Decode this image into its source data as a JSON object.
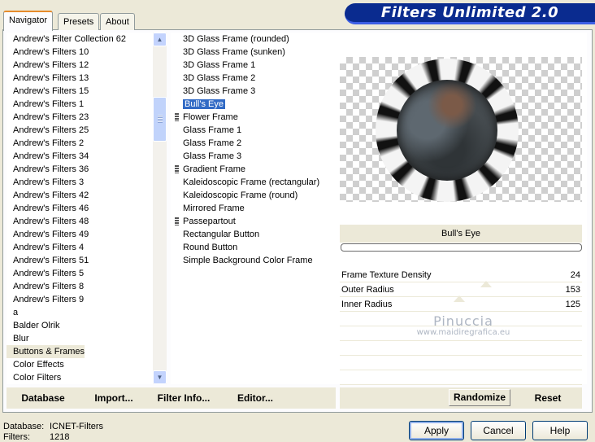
{
  "tabs": [
    {
      "label": "Navigator",
      "active": true
    },
    {
      "label": "Presets",
      "active": false
    },
    {
      "label": "About",
      "active": false
    }
  ],
  "banner": {
    "title": "Filters Unlimited 2.0"
  },
  "categories": {
    "items": [
      "Andrew's Filter Collection 62",
      "Andrew's Filters 10",
      "Andrew's Filters 12",
      "Andrew's Filters 13",
      "Andrew's Filters 15",
      "Andrew's Filters 1",
      "Andrew's Filters 23",
      "Andrew's Filters 25",
      "Andrew's Filters 2",
      "Andrew's Filters 34",
      "Andrew's Filters 36",
      "Andrew's Filters 3",
      "Andrew's Filters 42",
      "Andrew's Filters 46",
      "Andrew's Filters 48",
      "Andrew's Filters 49",
      "Andrew's Filters 4",
      "Andrew's Filters 51",
      "Andrew's Filters 5",
      "Andrew's Filters 8",
      "Andrew's Filters 9",
      "a",
      "Balder Olrik",
      "Blur",
      "Buttons & Frames",
      "Color Effects",
      "Color Filters"
    ],
    "selected_index": 24
  },
  "filters": {
    "items": [
      {
        "label": "3D Glass Frame (rounded)",
        "grip": false
      },
      {
        "label": "3D Glass Frame (sunken)",
        "grip": false
      },
      {
        "label": "3D Glass Frame 1",
        "grip": false
      },
      {
        "label": "3D Glass Frame 2",
        "grip": false
      },
      {
        "label": "3D Glass Frame 3",
        "grip": false
      },
      {
        "label": "Bull's Eye",
        "grip": false
      },
      {
        "label": "Flower Frame",
        "grip": true
      },
      {
        "label": "Glass Frame 1",
        "grip": false
      },
      {
        "label": "Glass Frame 2",
        "grip": false
      },
      {
        "label": "Glass Frame 3",
        "grip": false
      },
      {
        "label": "Gradient Frame",
        "grip": true
      },
      {
        "label": "Kaleidoscopic Frame (rectangular)",
        "grip": false
      },
      {
        "label": "Kaleidoscopic Frame (round)",
        "grip": false
      },
      {
        "label": "Mirrored Frame",
        "grip": false
      },
      {
        "label": "Passepartout",
        "grip": true
      },
      {
        "label": "Rectangular Button",
        "grip": false
      },
      {
        "label": "Round Button",
        "grip": false
      },
      {
        "label": "Simple Background Color Frame",
        "grip": false
      }
    ],
    "selected_index": 5
  },
  "preview": {
    "filter_name": "Bull's Eye"
  },
  "controls": [
    {
      "label": "Frame Texture Density",
      "value": "24"
    },
    {
      "label": "Outer Radius",
      "value": "153"
    },
    {
      "label": "Inner Radius",
      "value": "125"
    }
  ],
  "watermark": {
    "line1": "Pinuccia",
    "line2": "www.maidiregrafica.eu"
  },
  "strip_buttons": {
    "database": "Database",
    "import": "Import...",
    "filter_info": "Filter Info...",
    "editor": "Editor...",
    "randomize": "Randomize",
    "reset": "Reset"
  },
  "status": {
    "database_label": "Database:",
    "database_value": "ICNET-Filters",
    "filters_label": "Filters:",
    "filters_value": "1218"
  },
  "dialog_buttons": {
    "apply": "Apply",
    "cancel": "Cancel",
    "help": "Help"
  }
}
